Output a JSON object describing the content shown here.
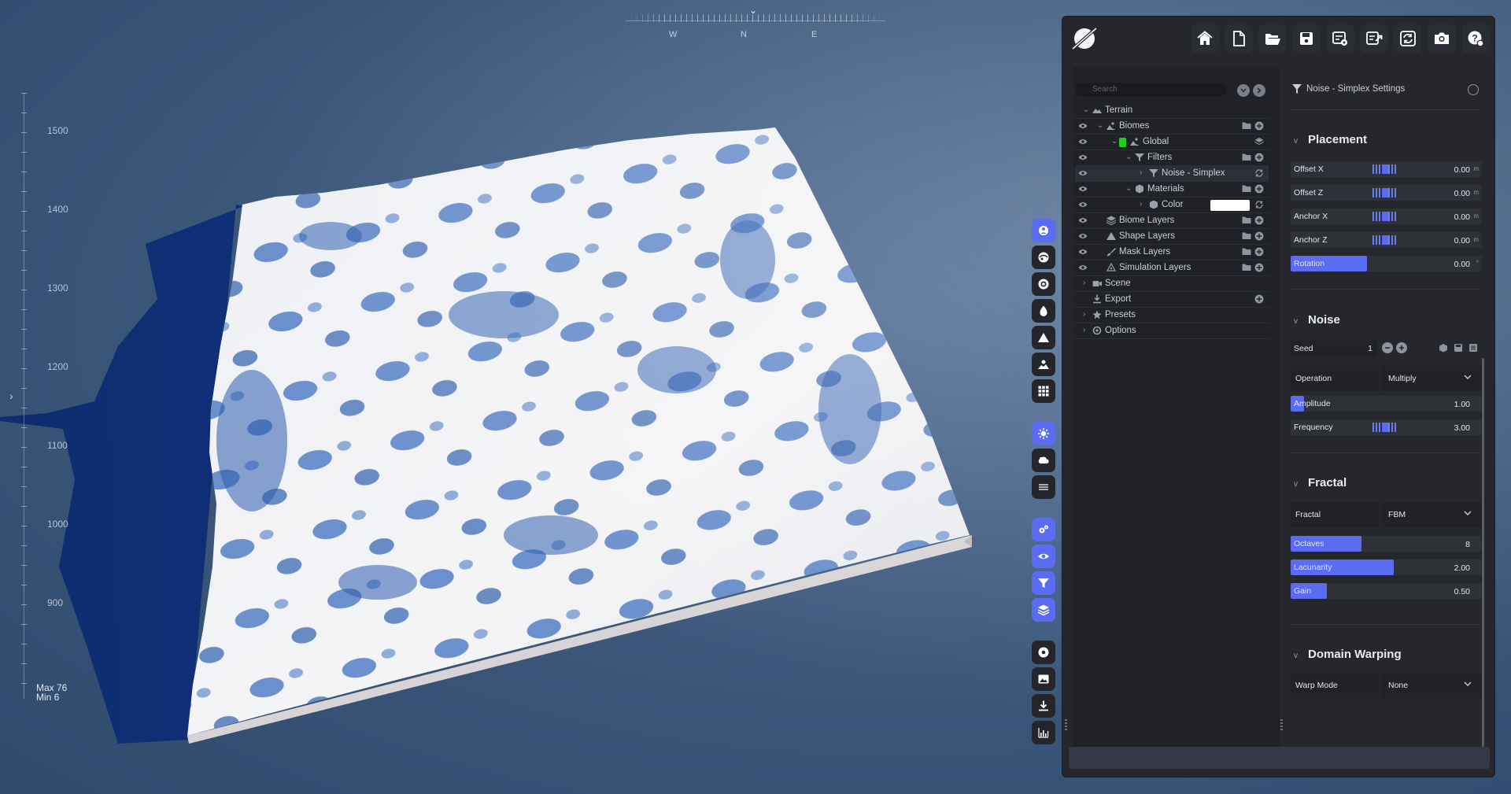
{
  "viewport": {
    "compass": {
      "west": "W",
      "north": "N",
      "east": "E",
      "chevron": "⌄"
    },
    "elevation_ticks": [
      "1500",
      "1400",
      "1300",
      "1200",
      "1100",
      "1000",
      "900"
    ],
    "elevation_max": "Max 76",
    "elevation_min": "Min 6",
    "terrain_colors": {
      "snow": "#f2f2f4",
      "shade": "#2f5fb0",
      "base": "#d8d4d6"
    }
  },
  "side_tools": [
    {
      "icon": "compass-icon",
      "active": true
    },
    {
      "icon": "globe-icon",
      "active": false
    },
    {
      "icon": "target-icon",
      "active": false
    },
    {
      "icon": "water-drop-icon",
      "active": false
    },
    {
      "icon": "mountain-icon",
      "active": false
    },
    {
      "icon": "landscape-icon",
      "active": false
    },
    {
      "icon": "grid-icon",
      "active": false
    },
    {
      "icon": "sun-icon",
      "active": true
    },
    {
      "icon": "cloud-icon",
      "active": false
    },
    {
      "icon": "fog-icon",
      "active": false
    },
    {
      "icon": "gears-icon",
      "active": true
    },
    {
      "icon": "eye-icon",
      "active": true
    },
    {
      "icon": "filter-icon",
      "active": true
    },
    {
      "icon": "layers-icon",
      "active": true
    },
    {
      "icon": "record-icon",
      "active": false
    },
    {
      "icon": "image-icon",
      "active": false
    },
    {
      "icon": "download-icon",
      "active": false
    },
    {
      "icon": "stats-icon",
      "active": false
    }
  ],
  "toolbar": {
    "buttons": [
      "home-icon",
      "new-file-icon",
      "open-folder-icon",
      "save-icon",
      "save-settings-icon",
      "export-icon",
      "refresh-icon",
      "camera-icon",
      "help-icon"
    ]
  },
  "tree": {
    "search_placeholder": "Search",
    "rows": [
      {
        "label": "Terrain",
        "indent": 0,
        "eye": false,
        "caret": "v"
      },
      {
        "label": "Biomes",
        "indent": 1,
        "eye": true,
        "caret": "v"
      },
      {
        "label": "Global",
        "indent": 2,
        "eye": true,
        "caret": "v"
      },
      {
        "label": "Filters",
        "indent": 3,
        "eye": true,
        "caret": "v"
      },
      {
        "label": "Noise - Simplex",
        "indent": 4,
        "eye": true,
        "caret": ">"
      },
      {
        "label": "Materials",
        "indent": 3,
        "eye": true,
        "caret": "v"
      },
      {
        "label": "Color",
        "indent": 4,
        "eye": true,
        "caret": ">"
      },
      {
        "label": "Biome Layers",
        "indent": 1,
        "eye": true,
        "caret": ""
      },
      {
        "label": "Shape Layers",
        "indent": 1,
        "eye": true,
        "caret": ""
      },
      {
        "label": "Mask Layers",
        "indent": 1,
        "eye": true,
        "caret": ""
      },
      {
        "label": "Simulation Layers",
        "indent": 1,
        "eye": true,
        "caret": ""
      },
      {
        "label": "Scene",
        "indent": 0,
        "eye": false,
        "caret": ">"
      },
      {
        "label": "Export",
        "indent": 0,
        "eye": false,
        "caret": ""
      },
      {
        "label": "Presets",
        "indent": 0,
        "eye": false,
        "caret": ">"
      },
      {
        "label": "Options",
        "indent": 0,
        "eye": false,
        "caret": ">"
      }
    ],
    "global_swatch": "#22cc22"
  },
  "settings": {
    "title": "Noise - Simplex Settings",
    "placement": {
      "title": "Placement",
      "offset_x_label": "Offset X",
      "offset_x_value": "0.00",
      "offset_x_unit": "m",
      "offset_z_label": "Offset Z",
      "offset_z_value": "0.00",
      "offset_z_unit": "m",
      "anchor_x_label": "Anchor X",
      "anchor_x_value": "0.00",
      "anchor_x_unit": "m",
      "anchor_z_label": "Anchor Z",
      "anchor_z_value": "0.00",
      "anchor_z_unit": "m",
      "rotation_label": "Rotation",
      "rotation_value": "0.00",
      "rotation_unit": "°",
      "rotation_fraction": 0.4
    },
    "noise": {
      "title": "Noise",
      "seed_label": "Seed",
      "seed_value": "1",
      "operation_label": "Operation",
      "operation_value": "Multiply",
      "amplitude_label": "Amplitude",
      "amplitude_value": "1.00",
      "amplitude_fraction": 0.07,
      "frequency_label": "Frequency",
      "frequency_value": "3.00"
    },
    "fractal": {
      "title": "Fractal",
      "fractal_label": "Fractal",
      "fractal_value": "FBM",
      "octaves_label": "Octaves",
      "octaves_value": "8",
      "octaves_fraction": 0.37,
      "lacunarity_label": "Lacunarity",
      "lacunarity_value": "2.00",
      "lacunarity_fraction": 0.54,
      "gain_label": "Gain",
      "gain_value": "0.50",
      "gain_fraction": 0.19
    },
    "domain_warping": {
      "title": "Domain Warping",
      "warp_mode_label": "Warp Mode",
      "warp_mode_value": "None"
    }
  },
  "accent_color": "#5b6cf2"
}
